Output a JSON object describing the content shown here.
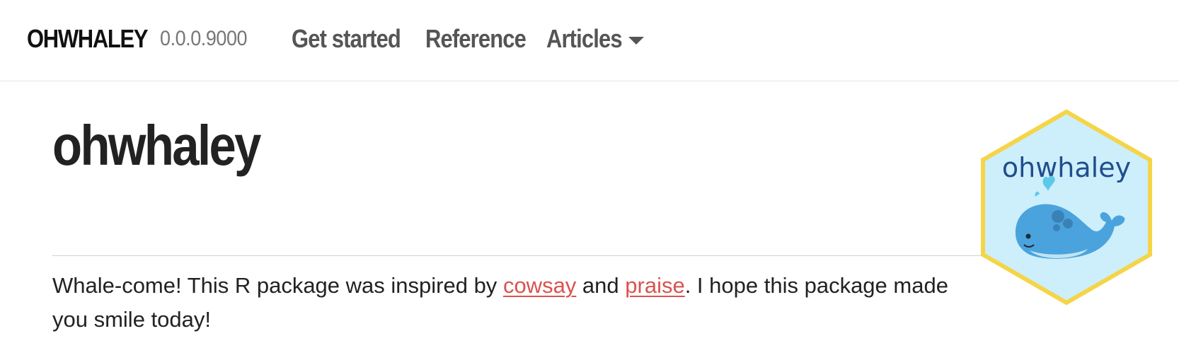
{
  "navbar": {
    "brand": "OHWHALEY",
    "version": "0.0.0.9000",
    "links": [
      {
        "label": "Get started"
      },
      {
        "label": "Reference"
      },
      {
        "label": "Articles",
        "has_dropdown": true
      }
    ]
  },
  "main": {
    "title": "ohwhaley",
    "intro_before": "Whale-come! This R package was inspired by ",
    "link_cowsay": "cowsay",
    "intro_middle": " and ",
    "link_praise": "praise",
    "intro_after": ". I hope this package made you smile today!"
  },
  "logo": {
    "text": "ohwhaley",
    "icon": "whale-hex-logo",
    "colors": {
      "border": "#f5d547",
      "fill": "#cdeefb",
      "text": "#1f4e8c",
      "whale": "#4aa3dc"
    }
  },
  "colors": {
    "link": "#d9534f",
    "nav_text": "#555555"
  }
}
